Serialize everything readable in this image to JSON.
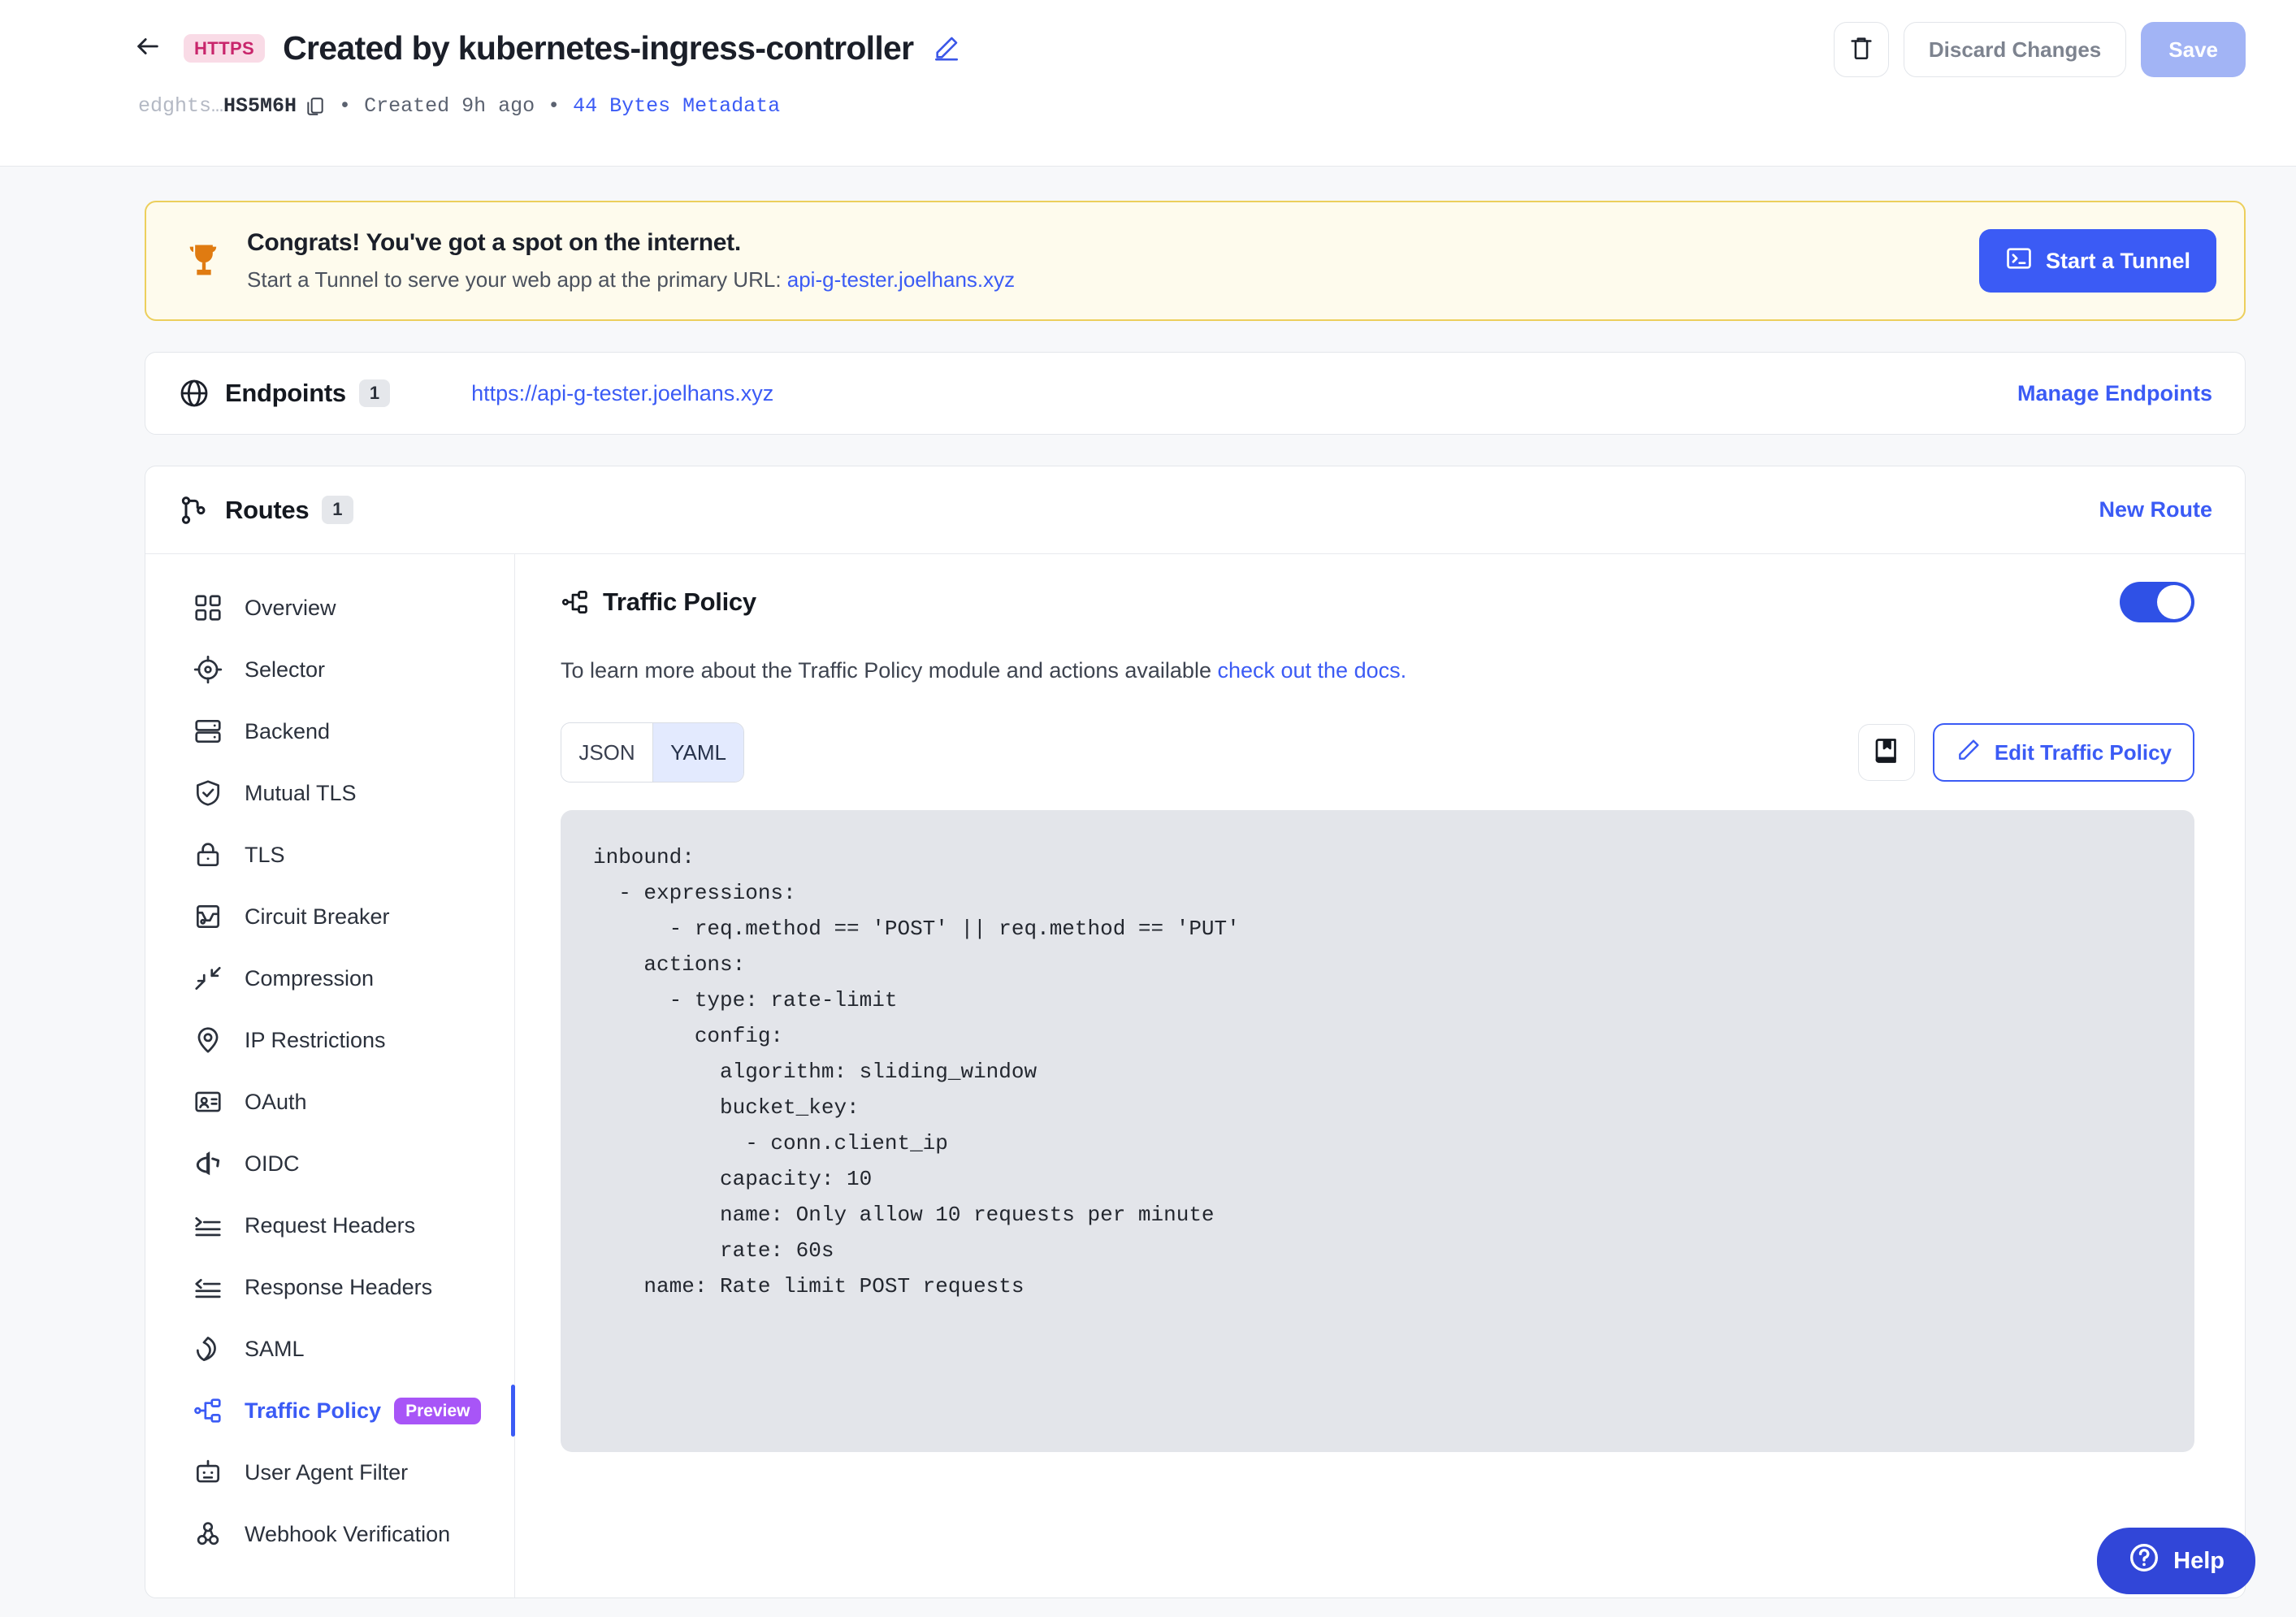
{
  "header": {
    "back_icon": "arrow-left-icon",
    "protocol_badge": "HTTPS",
    "title": "Created by kubernetes-ingress-controller",
    "edit_title_icon": "pencil-icon",
    "meta": {
      "id_prefix": "edghts…",
      "id_suffix": "HS5M6H",
      "copy_icon": "copy-icon",
      "separator": "•",
      "created": "Created 9h ago",
      "metadata_link": "44 Bytes Metadata"
    },
    "actions": {
      "delete_icon": "trash-icon",
      "discard_label": "Discard Changes",
      "save_label": "Save"
    }
  },
  "banner": {
    "icon": "trophy-icon",
    "title": "Congrats! You've got a spot on the internet.",
    "subtitle_prefix": "Start a Tunnel to serve your web app at the primary URL: ",
    "subtitle_link": "api-g-tester.joelhans.xyz",
    "button_icon": "terminal-icon",
    "button_label": "Start a Tunnel"
  },
  "endpoints": {
    "icon": "globe-icon",
    "title": "Endpoints",
    "count": "1",
    "url": "https://api-g-tester.joelhans.xyz",
    "manage_label": "Manage Endpoints"
  },
  "routes": {
    "icon": "route-icon",
    "title": "Routes",
    "count": "1",
    "new_route_label": "New Route"
  },
  "sidebar": {
    "items": [
      {
        "label": "Overview",
        "icon": "grid-icon",
        "active": false,
        "badge": null
      },
      {
        "label": "Selector",
        "icon": "target-icon",
        "active": false,
        "badge": null
      },
      {
        "label": "Backend",
        "icon": "server-icon",
        "active": false,
        "badge": null
      },
      {
        "label": "Mutual TLS",
        "icon": "shield-check-icon",
        "active": false,
        "badge": null
      },
      {
        "label": "TLS",
        "icon": "lock-icon",
        "active": false,
        "badge": null
      },
      {
        "label": "Circuit Breaker",
        "icon": "circuit-icon",
        "active": false,
        "badge": null
      },
      {
        "label": "Compression",
        "icon": "compress-arrows-icon",
        "active": false,
        "badge": null
      },
      {
        "label": "IP Restrictions",
        "icon": "map-pin-icon",
        "active": false,
        "badge": null
      },
      {
        "label": "OAuth",
        "icon": "id-card-icon",
        "active": false,
        "badge": null
      },
      {
        "label": "OIDC",
        "icon": "openid-icon",
        "active": false,
        "badge": null
      },
      {
        "label": "Request Headers",
        "icon": "request-headers-icon",
        "active": false,
        "badge": null
      },
      {
        "label": "Response Headers",
        "icon": "response-headers-icon",
        "active": false,
        "badge": null
      },
      {
        "label": "SAML",
        "icon": "saml-icon",
        "active": false,
        "badge": null
      },
      {
        "label": "Traffic Policy",
        "icon": "traffic-policy-icon",
        "active": true,
        "badge": "Preview"
      },
      {
        "label": "User Agent Filter",
        "icon": "robot-icon",
        "active": false,
        "badge": null
      },
      {
        "label": "Webhook Verification",
        "icon": "webhook-icon",
        "active": false,
        "badge": null
      }
    ]
  },
  "panel": {
    "icon": "traffic-policy-icon",
    "title": "Traffic Policy",
    "toggle_on": true,
    "description_prefix": "To learn more about the Traffic Policy module and actions available ",
    "description_link": "check out the docs.",
    "format_options": [
      "JSON",
      "YAML"
    ],
    "format_selected": "YAML",
    "book_icon": "book-icon",
    "edit_icon": "pencil-icon",
    "edit_label": "Edit Traffic Policy",
    "policy_yaml": "inbound:\n  - expressions:\n      - req.method == 'POST' || req.method == 'PUT'\n    actions:\n      - type: rate-limit\n        config:\n          algorithm: sliding_window\n          bucket_key:\n            - conn.client_ip\n          capacity: 10\n          name: Only allow 10 requests per minute\n          rate: 60s\n    name: Rate limit POST requests"
  },
  "help": {
    "icon": "question-circle-icon",
    "label": "Help"
  },
  "colors": {
    "accent": "#3b5bf5",
    "badge_https_bg": "#f9dbe6",
    "badge_https_fg": "#c8256b",
    "preview_badge": "#a855f7",
    "banner_bg": "#fefbed",
    "banner_border": "#eccf5c",
    "trophy": "#e07b11",
    "code_bg": "#e3e5ea",
    "save_button": "#a2b4f5",
    "help_fab": "#3146d8"
  }
}
